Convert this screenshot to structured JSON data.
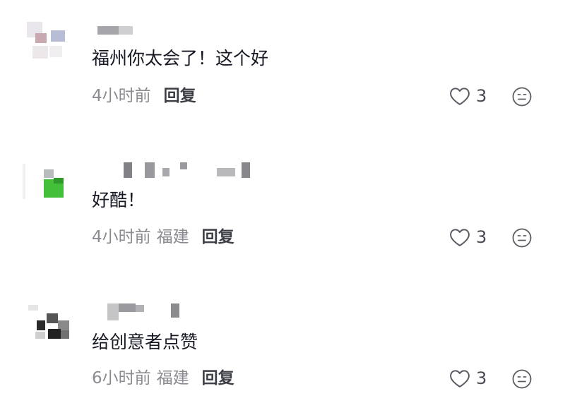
{
  "comments": [
    {
      "text": "福州你太会了！这个好",
      "time": "4小时前",
      "location": "",
      "reply_label": "回复",
      "like_count": "3"
    },
    {
      "text": "好酷！",
      "time": "4小时前",
      "location": "福建",
      "reply_label": "回复",
      "like_count": "3"
    },
    {
      "text": "给创意者点赞",
      "time": "6小时前",
      "location": "福建",
      "reply_label": "回复",
      "like_count": "3"
    }
  ],
  "icons": {
    "like": "heart-outline-icon",
    "reaction": "neutral-face-icon"
  },
  "colors": {
    "text": "#161823",
    "meta": "#8a8b91",
    "reply": "#3d3f46",
    "icon": "#5b5c63"
  }
}
